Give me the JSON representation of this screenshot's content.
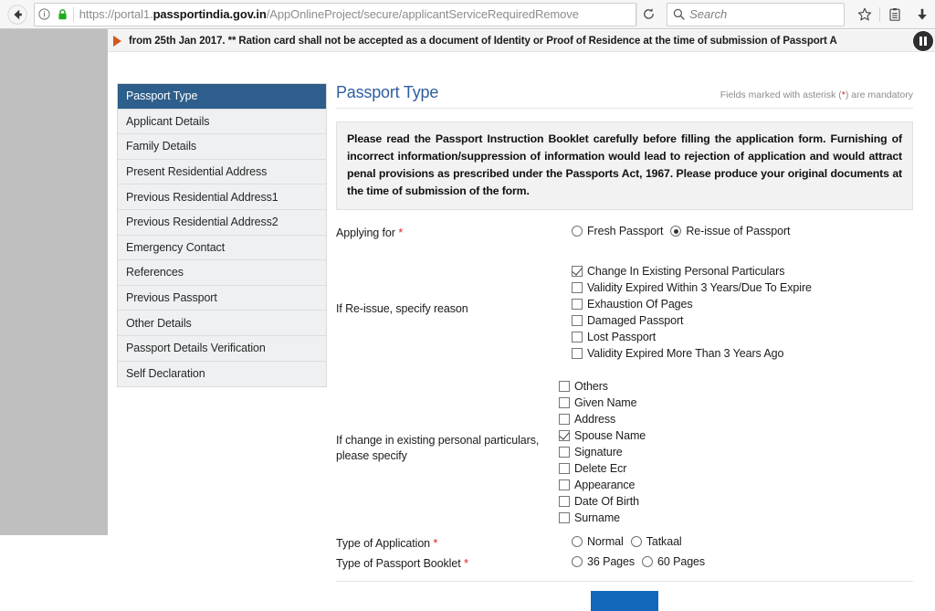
{
  "browser": {
    "back_label": "Back",
    "url_prefix": "https://portal1.",
    "url_host": "passportindia.gov.in",
    "url_path": "/AppOnlineProject/secure/applicantServiceRequiredRemove",
    "reload_label": "Reload",
    "search_placeholder": "Search",
    "bookmark_label": "Bookmark this page",
    "library_label": "Library",
    "downloads_label": "Downloads"
  },
  "marquee": {
    "text": "from 25th Jan 2017. ** Ration card shall not be accepted as a document of Identity or Proof of Residence at the time of submission of Passport A",
    "pause_label": "Pause"
  },
  "sidebar": {
    "items": [
      {
        "label": "Passport Type",
        "active": true
      },
      {
        "label": "Applicant Details",
        "active": false
      },
      {
        "label": "Family Details",
        "active": false
      },
      {
        "label": "Present Residential Address",
        "active": false
      },
      {
        "label": "Previous Residential Address1",
        "active": false
      },
      {
        "label": "Previous Residential Address2",
        "active": false
      },
      {
        "label": "Emergency Contact",
        "active": false
      },
      {
        "label": "References",
        "active": false
      },
      {
        "label": "Previous Passport",
        "active": false
      },
      {
        "label": "Other Details",
        "active": false
      },
      {
        "label": "Passport Details Verification",
        "active": false
      },
      {
        "label": "Self Declaration",
        "active": false
      }
    ]
  },
  "main": {
    "title": "Passport Type",
    "mandatory_note_before": "Fields marked with asterisk (",
    "mandatory_note_asterisk": "*",
    "mandatory_note_after": ") are mandatory",
    "instruction": "Please read the Passport Instruction Booklet carefully before filling the application form. Furnishing of incorrect information/suppression of information would lead to rejection of application and would attract penal provisions as prescribed under the Passports Act, 1967. Please produce your original documents at the time of submission of the form.",
    "fields": {
      "applying_for": {
        "label": "Applying for",
        "required": true,
        "options": [
          {
            "label": "Fresh Passport",
            "selected": false
          },
          {
            "label": "Re-issue of Passport",
            "selected": true
          }
        ]
      },
      "reissue_reason": {
        "label": "If Re-issue, specify reason",
        "required": false,
        "options": [
          {
            "label": "Change In Existing Personal Particulars",
            "checked": true
          },
          {
            "label": "Validity Expired Within 3 Years/Due To Expire",
            "checked": false
          },
          {
            "label": "Exhaustion Of Pages",
            "checked": false
          },
          {
            "label": "Damaged Passport",
            "checked": false
          },
          {
            "label": "Lost Passport",
            "checked": false
          },
          {
            "label": "Validity Expired More Than 3 Years Ago",
            "checked": false
          }
        ]
      },
      "particulars_change": {
        "label": "If change in existing personal particulars, please specify",
        "required": false,
        "options": [
          {
            "label": "Others",
            "checked": false
          },
          {
            "label": "Given Name",
            "checked": false
          },
          {
            "label": "Address",
            "checked": false
          },
          {
            "label": "Spouse Name",
            "checked": true
          },
          {
            "label": "Signature",
            "checked": false
          },
          {
            "label": "Delete Ecr",
            "checked": false
          },
          {
            "label": "Appearance",
            "checked": false
          },
          {
            "label": "Date Of Birth",
            "checked": false
          },
          {
            "label": "Surname",
            "checked": false
          }
        ]
      },
      "application_type": {
        "label": "Type of Application",
        "required": true,
        "options": [
          {
            "label": "Normal",
            "selected": false
          },
          {
            "label": "Tatkaal",
            "selected": false
          }
        ]
      },
      "booklet_type": {
        "label": "Type of Passport Booklet",
        "required": true,
        "options": [
          {
            "label": "36 Pages",
            "selected": false
          },
          {
            "label": "60 Pages",
            "selected": false
          }
        ]
      }
    },
    "submit_label": ""
  },
  "colors": {
    "accent_blue": "#2e5e8b",
    "title_blue": "#2f5fa0",
    "button_blue": "#1368bd",
    "required_red": "#e02020",
    "marquee_arrow": "#d4581d"
  }
}
